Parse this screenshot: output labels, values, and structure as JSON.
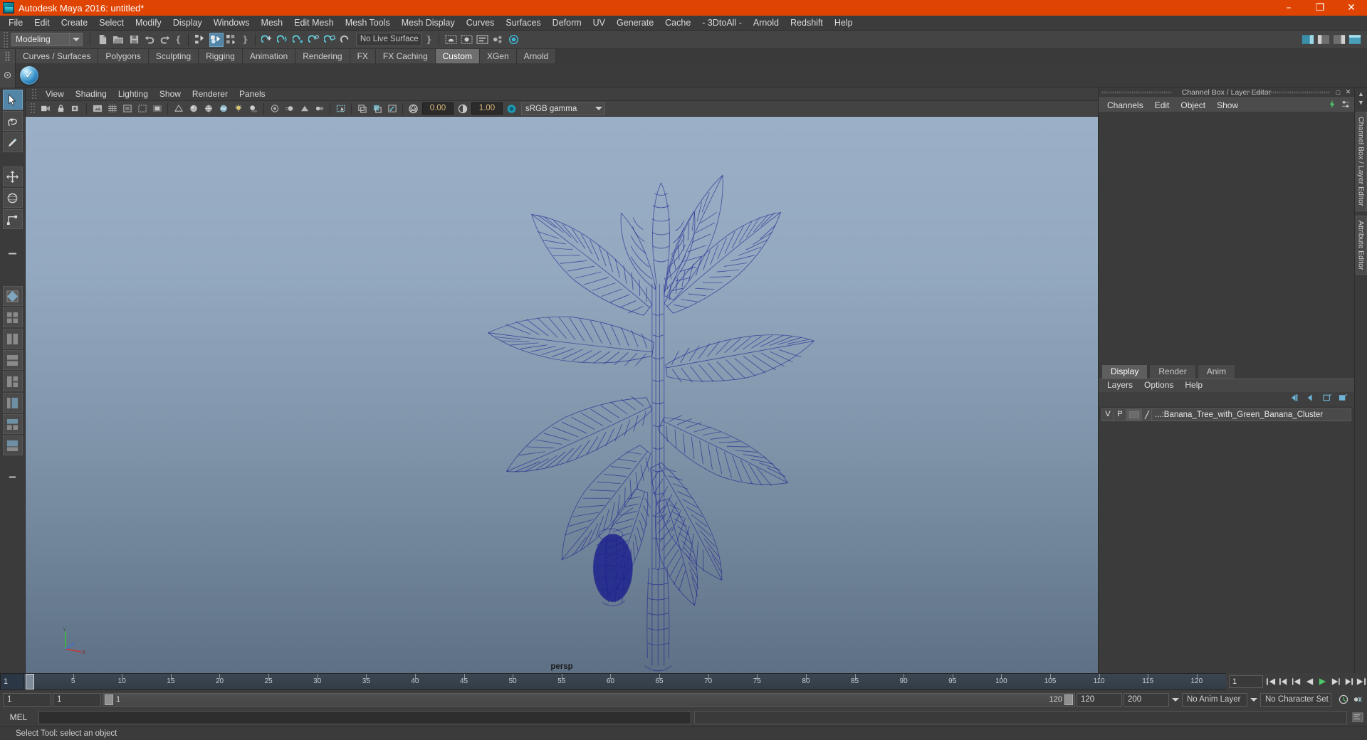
{
  "app": {
    "title": "Autodesk Maya 2016: untitled*",
    "logo_icon": "maya-logo-icon",
    "window_buttons": [
      {
        "name": "minimize-button",
        "glyph": "–"
      },
      {
        "name": "maximize-button",
        "glyph": "❐"
      },
      {
        "name": "close-button",
        "glyph": "✕"
      }
    ]
  },
  "menubar": {
    "items": [
      "File",
      "Edit",
      "Create",
      "Select",
      "Modify",
      "Display",
      "Windows",
      "Mesh",
      "Edit Mesh",
      "Mesh Tools",
      "Mesh Display",
      "Curves",
      "Surfaces",
      "Deform",
      "UV",
      "Generate",
      "Cache",
      "- 3DtoAll -",
      "Arnold",
      "Redshift",
      "Help"
    ]
  },
  "statusbar": {
    "mode": "Modeling",
    "live_surface": "No Live Surface",
    "menu_set_dropdown_icon": "chevron-down-icon"
  },
  "shelf": {
    "tabs": [
      "Curves / Surfaces",
      "Polygons",
      "Sculpting",
      "Rigging",
      "Animation",
      "Rendering",
      "FX",
      "FX Caching",
      "Custom",
      "XGen",
      "Arnold"
    ],
    "active_tab": "Custom",
    "item_icon": "blue-sphere-checkmark-icon"
  },
  "viewport": {
    "menus": [
      "View",
      "Shading",
      "Lighting",
      "Show",
      "Renderer",
      "Panels"
    ],
    "camera_label": "persp",
    "exposure_value": "0.00",
    "gamma_value": "1.00",
    "color_management": "sRGB gamma",
    "color_management_arrow_icon": "chevron-down-icon",
    "wireframe_color": "#1b1f8e",
    "background_top": "#9bb0c6",
    "background_bottom": "#5d7085",
    "axis_gizmo": {
      "y": "Y",
      "x": "X",
      "z": "Z"
    }
  },
  "channel_box": {
    "panel_title": "Channel Box / Layer Editor",
    "menus": [
      "Channels",
      "Edit",
      "Object",
      "Show"
    ],
    "window_buttons": [
      {
        "name": "panel-undock-button",
        "glyph": "□"
      },
      {
        "name": "panel-close-button",
        "glyph": "✕"
      }
    ]
  },
  "layer_editor": {
    "tabs": [
      "Display",
      "Render",
      "Anim"
    ],
    "active_tab": "Display",
    "menus": [
      "Layers",
      "Options",
      "Help"
    ],
    "buttons": [
      {
        "name": "layer-first-icon"
      },
      {
        "name": "layer-prev-icon"
      },
      {
        "name": "layer-new-empty-icon"
      },
      {
        "name": "layer-new-selected-icon"
      }
    ],
    "columns": {
      "visibility": "V",
      "playback": "P"
    },
    "layers": [
      {
        "visible": "V",
        "playback": "P",
        "name": "...:Banana_Tree_with_Green_Banana_Cluster"
      }
    ]
  },
  "timeline": {
    "start_field": "1",
    "current_frame": "1",
    "ticks": [
      5,
      10,
      15,
      20,
      25,
      30,
      35,
      40,
      45,
      50,
      55,
      60,
      65,
      70,
      75,
      80,
      85,
      90,
      95,
      100,
      105,
      110,
      115,
      120
    ],
    "tick_max": 120,
    "playback_buttons": [
      {
        "name": "go-to-start-button"
      },
      {
        "name": "step-back-keyframe-button"
      },
      {
        "name": "step-back-frame-button"
      },
      {
        "name": "play-backwards-button"
      },
      {
        "name": "play-forwards-button"
      },
      {
        "name": "step-forward-frame-button"
      },
      {
        "name": "step-forward-keyframe-button"
      },
      {
        "name": "go-to-end-button"
      }
    ]
  },
  "range": {
    "anim_start": "1",
    "playback_start": "1",
    "slider_left_label": "1",
    "slider_right_label": "120",
    "playback_end": "120",
    "anim_end": "200",
    "anim_layer": "No Anim Layer",
    "character_set": "No Character Set",
    "anim_layer_arrow_icon": "chevron-down-icon",
    "auto_key_icon": "auto-keyframe-icon",
    "prefs_icon": "animation-preferences-icon"
  },
  "command_line": {
    "label": "MEL",
    "input_value": "",
    "output_value": ""
  },
  "help_line": {
    "text": "Select Tool: select an object"
  },
  "side_tabs": {
    "items": [
      "Channel Box / Layer Editor",
      "Attribute Editor"
    ],
    "collapse_up_icon": "chevron-up-icon",
    "collapse_down_icon": "chevron-down-icon"
  },
  "toolbox": {
    "items": [
      {
        "name": "select-tool",
        "selected": true
      },
      {
        "name": "lasso-select-tool",
        "selected": false
      },
      {
        "name": "paint-select-tool",
        "selected": false
      },
      {
        "name": "move-tool",
        "selected": false
      },
      {
        "name": "rotate-tool",
        "selected": false
      },
      {
        "name": "scale-tool",
        "selected": false
      },
      {
        "name": "last-tool-used",
        "selected": false
      }
    ],
    "layout_presets": [
      {
        "name": "single-perspective-view"
      },
      {
        "name": "four-view-layout"
      },
      {
        "name": "two-pane-side-by-side"
      },
      {
        "name": "two-pane-stacked"
      },
      {
        "name": "three-pane-layout"
      },
      {
        "name": "outliner-persp-layout"
      },
      {
        "name": "hypershade-layout"
      },
      {
        "name": "persp-graph-layout"
      }
    ]
  }
}
